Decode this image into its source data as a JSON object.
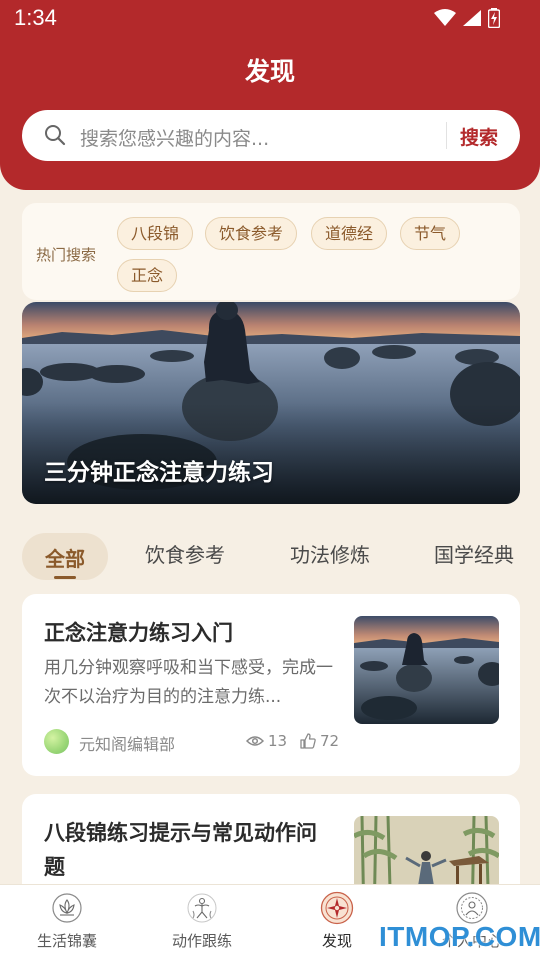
{
  "status_bar": {
    "time": "1:34"
  },
  "header": {
    "title": "发现"
  },
  "search": {
    "placeholder": "搜索您感兴趣的内容...",
    "button_label": "搜索"
  },
  "hot_search": {
    "label": "热门搜索",
    "tags": [
      "八段锦",
      "饮食参考",
      "道德经",
      "节气",
      "正念"
    ]
  },
  "banner": {
    "title": "三分钟正念注意力练习"
  },
  "tabs": [
    {
      "label": "全部",
      "active": true
    },
    {
      "label": "饮食参考",
      "active": false
    },
    {
      "label": "功法修炼",
      "active": false
    },
    {
      "label": "国学经典",
      "active": false
    }
  ],
  "articles": [
    {
      "title": "正念注意力练习入门",
      "description": "用几分钟观察呼吸和当下感受，完成一次不以治疗为目的的注意力练...",
      "author": "元知阁编辑部",
      "views": "13",
      "likes": "72"
    },
    {
      "title": "八段锦练习提示与常见动作问题",
      "description": "",
      "author": "",
      "views": "",
      "likes": ""
    }
  ],
  "bottom_nav": [
    {
      "label": "生活锦囊",
      "icon": "lotus-icon",
      "active": false
    },
    {
      "label": "动作跟练",
      "icon": "figure-icon",
      "active": false
    },
    {
      "label": "发现",
      "icon": "compass-icon",
      "active": true
    },
    {
      "label": "个人中心",
      "icon": "profile-icon",
      "active": false
    }
  ],
  "watermark": "ITMOP.COM",
  "colors": {
    "brand_red": "#b3292b",
    "accent_brown": "#8b5a2b",
    "background": "#f6efe4"
  }
}
